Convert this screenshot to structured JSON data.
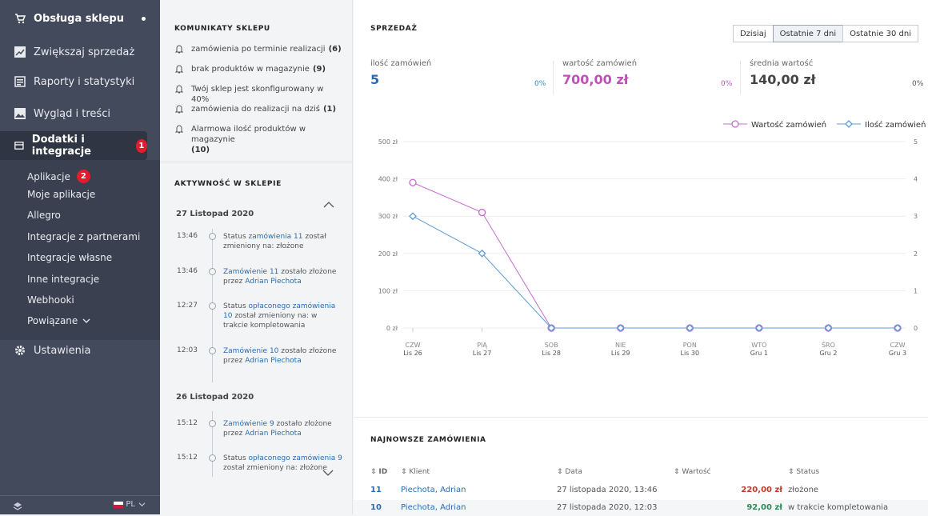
{
  "sidebar": {
    "nav": [
      {
        "label": "Obsługa sklepu",
        "icon": "cart-icon"
      },
      {
        "label": "Zwiększaj sprzedaż",
        "icon": "chart-icon"
      },
      {
        "label": "Raporty i statystyki",
        "icon": "report-icon"
      },
      {
        "label": "Wygląd i treści",
        "icon": "image-icon"
      },
      {
        "label": "Dodatki i integracje",
        "icon": "plugin-icon",
        "badge": "1"
      },
      {
        "label": "Ustawienia",
        "icon": "gear-icon"
      }
    ],
    "sub": [
      {
        "label": "Aplikacje",
        "badge": "2"
      },
      {
        "label": "Moje aplikacje"
      },
      {
        "label": "Allegro"
      },
      {
        "label": "Integracje z partnerami"
      },
      {
        "label": "Integracje własne"
      },
      {
        "label": "Inne integracje"
      },
      {
        "label": "Webhooki"
      },
      {
        "label": "Powiązane"
      }
    ],
    "lang": "PL"
  },
  "notices": {
    "title": "KOMUNIKATY SKLEPU",
    "items": [
      {
        "text": "zamówienia po terminie realizacji",
        "count": "(6)"
      },
      {
        "text": "brak produktów w magazynie",
        "count": "(9)"
      },
      {
        "text": "Twój sklep jest skonfigurowany w 40%",
        "count": ""
      },
      {
        "text": "zamówienia do realizacji na dziś",
        "count": "(1)"
      },
      {
        "text": "Alarmowa ilość produktów w magazynie",
        "count": "(10)"
      }
    ]
  },
  "activity": {
    "title": "AKTYWNOŚĆ W SKLEPIE",
    "day1": "27 Listopad 2020",
    "day2": "26 Listopad 2020",
    "events": [
      {
        "time": "13:46",
        "pre": "Status ",
        "link": "zamówienia 11",
        "post": " został zmieniony na: złożone",
        "link2": ""
      },
      {
        "time": "13:46",
        "pre": "",
        "link": "Zamówienie 11",
        "post": " zostało złożone przez ",
        "link2": "Adrian Piechota"
      },
      {
        "time": "12:27",
        "pre": "Status ",
        "link": "opłaconego zamówienia 10",
        "post": " został zmieniony na: w trakcie kompletowania",
        "link2": ""
      },
      {
        "time": "12:03",
        "pre": "",
        "link": "Zamówienie 10",
        "post": " zostało złożone przez ",
        "link2": "Adrian Piechota"
      },
      {
        "time": "15:12",
        "pre": "",
        "link": "Zamówienie 9",
        "post": " zostało złożone przez ",
        "link2": "Adrian Piechota"
      },
      {
        "time": "15:12",
        "pre": "Status ",
        "link": "opłaconego zamówienia 9",
        "post": " został zmieniony na: złożone",
        "link2": ""
      }
    ]
  },
  "sales": {
    "title": "SPRZEDAŻ",
    "periods": [
      "Dzisiaj",
      "Ostatnie 7 dni",
      "Ostatnie 30 dni"
    ],
    "selected_period": "Ostatnie 7 dni",
    "stats": [
      {
        "label": "ilość zamówień",
        "value": "5",
        "pct": "0%"
      },
      {
        "label": "wartość zamówień",
        "value": "700,00 zł",
        "pct": "0%"
      },
      {
        "label": "średnia wartość",
        "value": "140,00 zł",
        "pct": "0%"
      }
    ]
  },
  "chart_data": {
    "type": "line",
    "categories": [
      {
        "day": "CZW",
        "date": "Lis 26"
      },
      {
        "day": "PIĄ",
        "date": "Lis 27"
      },
      {
        "day": "SOB",
        "date": "Lis 28"
      },
      {
        "day": "NIE",
        "date": "Lis 29"
      },
      {
        "day": "PON",
        "date": "Lis 30"
      },
      {
        "day": "WTO",
        "date": "Gru 1"
      },
      {
        "day": "ŚRO",
        "date": "Gru 2"
      },
      {
        "day": "CZW",
        "date": "Gru 3"
      }
    ],
    "series": [
      {
        "name": "Wartość zamówień",
        "axis": "left",
        "color": "#c66ccf",
        "marker": "circle",
        "values": [
          390,
          310,
          0,
          0,
          0,
          0,
          0,
          0
        ]
      },
      {
        "name": "Ilość zamówień",
        "axis": "right",
        "color": "#5b9bd5",
        "marker": "diamond",
        "values": [
          3,
          2,
          0,
          0,
          0,
          0,
          0,
          0
        ]
      }
    ],
    "y_left": {
      "ticks": [
        "0 zł",
        "100 zł",
        "200 zł",
        "300 zł",
        "400 zł",
        "500 zł"
      ],
      "range": [
        0,
        500
      ]
    },
    "y_right": {
      "ticks": [
        "0",
        "1",
        "2",
        "3",
        "4",
        "5"
      ],
      "range": [
        0,
        5
      ]
    },
    "grid": true,
    "legend": "top-right"
  },
  "orders": {
    "title": "NAJNOWSZE ZAMÓWIENIA",
    "columns": [
      "ID",
      "Klient",
      "Data",
      "Wartość",
      "Status"
    ],
    "rows": [
      {
        "id": "11",
        "client": "Piechota, Adrian",
        "date": "27 listopada 2020, 13:46",
        "value": "220,00 zł",
        "status": "złożone",
        "value_color": "#c0392b"
      },
      {
        "id": "10",
        "client": "Piechota, Adrian",
        "date": "27 listopada 2020, 12:03",
        "value": "92,00 zł",
        "status": "w trakcie kompletowania",
        "value_color": "#2e8b57"
      }
    ]
  },
  "colors": {
    "sidebar": "#434a5b",
    "accent_blue": "#2b6cb0",
    "badge_red": "#e11d2c",
    "stat_purple": "#c050b8"
  }
}
